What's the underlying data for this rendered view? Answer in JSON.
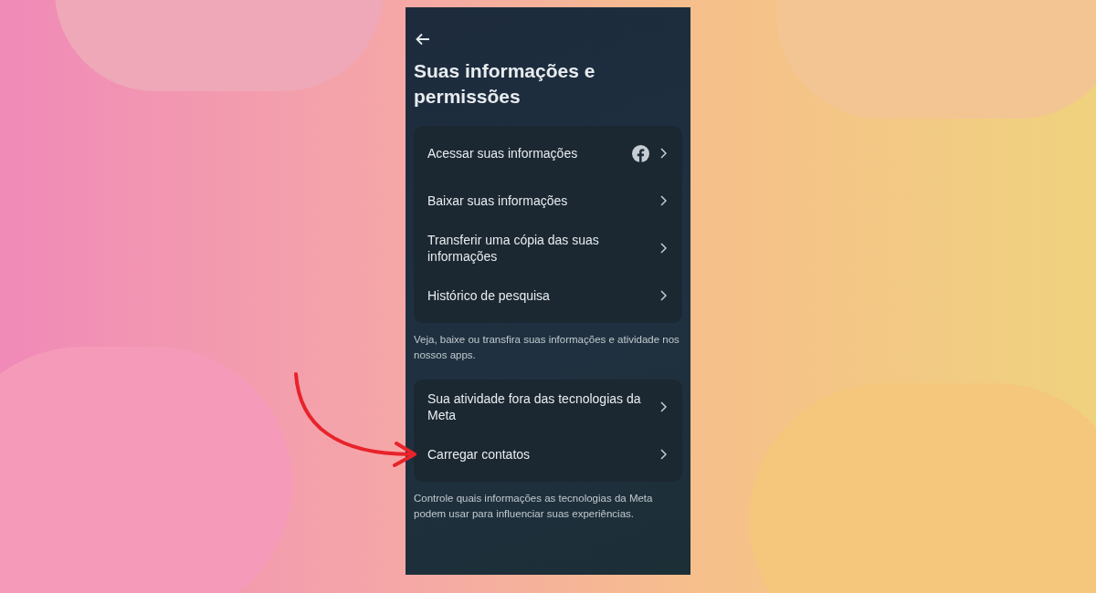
{
  "title": "Suas informações e permissões",
  "sections": [
    {
      "items": [
        {
          "label": "Acessar suas informações",
          "kind": "facebook"
        },
        {
          "label": "Baixar suas informações",
          "kind": "plain"
        },
        {
          "label": "Transferir uma cópia das suas informações",
          "kind": "plain"
        },
        {
          "label": "Histórico de pesquisa",
          "kind": "plain"
        }
      ],
      "note": "Veja, baixe ou transfira suas informações e atividade nos nossos apps."
    },
    {
      "items": [
        {
          "label": "Sua atividade fora das tecnologias da Meta",
          "kind": "plain"
        },
        {
          "label": "Carregar contatos",
          "kind": "plain"
        }
      ],
      "note": "Controle quais informações as tecnologias da Meta podem usar para influenciar suas experiências."
    }
  ]
}
